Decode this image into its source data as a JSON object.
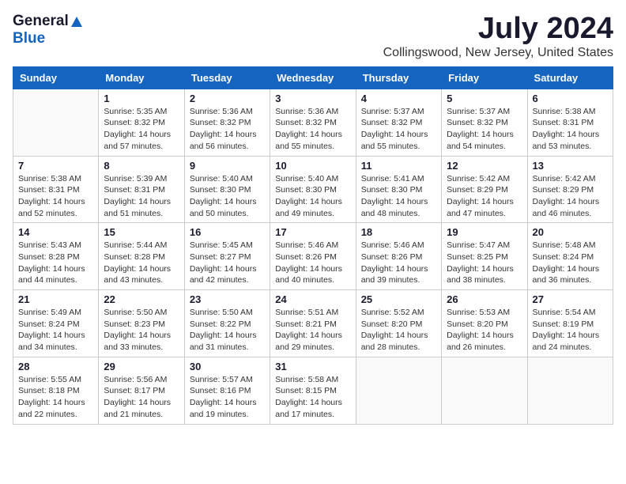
{
  "logo": {
    "general": "General",
    "blue": "Blue"
  },
  "title": "July 2024",
  "location": "Collingswood, New Jersey, United States",
  "days_of_week": [
    "Sunday",
    "Monday",
    "Tuesday",
    "Wednesday",
    "Thursday",
    "Friday",
    "Saturday"
  ],
  "weeks": [
    [
      {
        "day": "",
        "info": ""
      },
      {
        "day": "1",
        "info": "Sunrise: 5:35 AM\nSunset: 8:32 PM\nDaylight: 14 hours\nand 57 minutes."
      },
      {
        "day": "2",
        "info": "Sunrise: 5:36 AM\nSunset: 8:32 PM\nDaylight: 14 hours\nand 56 minutes."
      },
      {
        "day": "3",
        "info": "Sunrise: 5:36 AM\nSunset: 8:32 PM\nDaylight: 14 hours\nand 55 minutes."
      },
      {
        "day": "4",
        "info": "Sunrise: 5:37 AM\nSunset: 8:32 PM\nDaylight: 14 hours\nand 55 minutes."
      },
      {
        "day": "5",
        "info": "Sunrise: 5:37 AM\nSunset: 8:32 PM\nDaylight: 14 hours\nand 54 minutes."
      },
      {
        "day": "6",
        "info": "Sunrise: 5:38 AM\nSunset: 8:31 PM\nDaylight: 14 hours\nand 53 minutes."
      }
    ],
    [
      {
        "day": "7",
        "info": "Sunrise: 5:38 AM\nSunset: 8:31 PM\nDaylight: 14 hours\nand 52 minutes."
      },
      {
        "day": "8",
        "info": "Sunrise: 5:39 AM\nSunset: 8:31 PM\nDaylight: 14 hours\nand 51 minutes."
      },
      {
        "day": "9",
        "info": "Sunrise: 5:40 AM\nSunset: 8:30 PM\nDaylight: 14 hours\nand 50 minutes."
      },
      {
        "day": "10",
        "info": "Sunrise: 5:40 AM\nSunset: 8:30 PM\nDaylight: 14 hours\nand 49 minutes."
      },
      {
        "day": "11",
        "info": "Sunrise: 5:41 AM\nSunset: 8:30 PM\nDaylight: 14 hours\nand 48 minutes."
      },
      {
        "day": "12",
        "info": "Sunrise: 5:42 AM\nSunset: 8:29 PM\nDaylight: 14 hours\nand 47 minutes."
      },
      {
        "day": "13",
        "info": "Sunrise: 5:42 AM\nSunset: 8:29 PM\nDaylight: 14 hours\nand 46 minutes."
      }
    ],
    [
      {
        "day": "14",
        "info": "Sunrise: 5:43 AM\nSunset: 8:28 PM\nDaylight: 14 hours\nand 44 minutes."
      },
      {
        "day": "15",
        "info": "Sunrise: 5:44 AM\nSunset: 8:28 PM\nDaylight: 14 hours\nand 43 minutes."
      },
      {
        "day": "16",
        "info": "Sunrise: 5:45 AM\nSunset: 8:27 PM\nDaylight: 14 hours\nand 42 minutes."
      },
      {
        "day": "17",
        "info": "Sunrise: 5:46 AM\nSunset: 8:26 PM\nDaylight: 14 hours\nand 40 minutes."
      },
      {
        "day": "18",
        "info": "Sunrise: 5:46 AM\nSunset: 8:26 PM\nDaylight: 14 hours\nand 39 minutes."
      },
      {
        "day": "19",
        "info": "Sunrise: 5:47 AM\nSunset: 8:25 PM\nDaylight: 14 hours\nand 38 minutes."
      },
      {
        "day": "20",
        "info": "Sunrise: 5:48 AM\nSunset: 8:24 PM\nDaylight: 14 hours\nand 36 minutes."
      }
    ],
    [
      {
        "day": "21",
        "info": "Sunrise: 5:49 AM\nSunset: 8:24 PM\nDaylight: 14 hours\nand 34 minutes."
      },
      {
        "day": "22",
        "info": "Sunrise: 5:50 AM\nSunset: 8:23 PM\nDaylight: 14 hours\nand 33 minutes."
      },
      {
        "day": "23",
        "info": "Sunrise: 5:50 AM\nSunset: 8:22 PM\nDaylight: 14 hours\nand 31 minutes."
      },
      {
        "day": "24",
        "info": "Sunrise: 5:51 AM\nSunset: 8:21 PM\nDaylight: 14 hours\nand 29 minutes."
      },
      {
        "day": "25",
        "info": "Sunrise: 5:52 AM\nSunset: 8:20 PM\nDaylight: 14 hours\nand 28 minutes."
      },
      {
        "day": "26",
        "info": "Sunrise: 5:53 AM\nSunset: 8:20 PM\nDaylight: 14 hours\nand 26 minutes."
      },
      {
        "day": "27",
        "info": "Sunrise: 5:54 AM\nSunset: 8:19 PM\nDaylight: 14 hours\nand 24 minutes."
      }
    ],
    [
      {
        "day": "28",
        "info": "Sunrise: 5:55 AM\nSunset: 8:18 PM\nDaylight: 14 hours\nand 22 minutes."
      },
      {
        "day": "29",
        "info": "Sunrise: 5:56 AM\nSunset: 8:17 PM\nDaylight: 14 hours\nand 21 minutes."
      },
      {
        "day": "30",
        "info": "Sunrise: 5:57 AM\nSunset: 8:16 PM\nDaylight: 14 hours\nand 19 minutes."
      },
      {
        "day": "31",
        "info": "Sunrise: 5:58 AM\nSunset: 8:15 PM\nDaylight: 14 hours\nand 17 minutes."
      },
      {
        "day": "",
        "info": ""
      },
      {
        "day": "",
        "info": ""
      },
      {
        "day": "",
        "info": ""
      }
    ]
  ]
}
